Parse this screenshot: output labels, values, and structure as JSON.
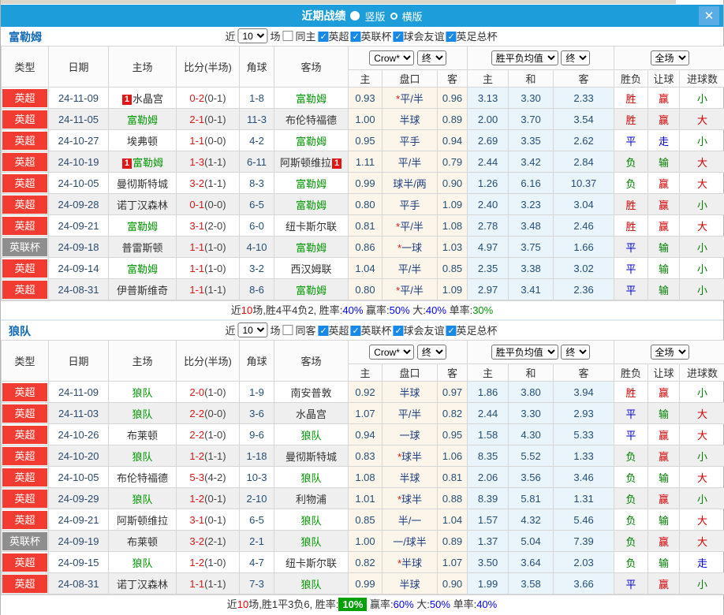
{
  "titlebar": {
    "title": "近期战绩",
    "radio_vertical": "竖版",
    "radio_horizontal": "横版",
    "close": "✕"
  },
  "colors": {
    "titlebar_blue": "#1d9dd9",
    "league_red": "#f23b31",
    "league_gray": "#8e8e8e",
    "focus_team_green": "#009900",
    "win_red": "#d50000",
    "draw_blue": "#0000dd",
    "lose_green": "#008000",
    "odds_cream_bg": "#fcf6ea",
    "avg_blue_bg": "#e9f4fb",
    "highlight_green_bg": "#00a000"
  },
  "headers": {
    "type": "类型",
    "date": "日期",
    "home": "主场",
    "score_half": "比分(半场)",
    "corner": "角球",
    "away": "客场",
    "sub": [
      "主",
      "盘口",
      "客",
      "主",
      "和",
      "客",
      "胜负",
      "让球",
      "进球数"
    ],
    "selects": {
      "bookmaker": "Crow*",
      "final": "终",
      "avg": "胜平负均值",
      "final2": "终",
      "scope": "全场"
    }
  },
  "sections": [
    {
      "team": "富勒姆",
      "filter": {
        "near": "近",
        "count": "10",
        "unit": "场",
        "same": "同主",
        "same_checked": false,
        "leagues": [
          {
            "label": "英超",
            "checked": true
          },
          {
            "label": "英联杯",
            "checked": true
          },
          {
            "label": "球会友谊",
            "checked": true
          },
          {
            "label": "英足总杯",
            "checked": true
          }
        ]
      },
      "rows": [
        {
          "lg": "英超",
          "lgc": "red",
          "date": "24-11-09",
          "h": {
            "n": "水晶宫",
            "g": 0,
            "b": "pre"
          },
          "s": "0-2",
          "sh": "0-1",
          "c": "1-8",
          "a": {
            "n": "富勒姆",
            "g": 1
          },
          "o": [
            "0.93",
            "*平/半",
            "0.96"
          ],
          "v": [
            "3.13",
            "3.30",
            "2.33"
          ],
          "r": [
            "胜",
            "赢",
            "小"
          ]
        },
        {
          "lg": "英超",
          "lgc": "red",
          "date": "24-11-05",
          "h": {
            "n": "富勒姆",
            "g": 1
          },
          "s": "2-1",
          "sh": "0-1",
          "c": "11-3",
          "a": {
            "n": "布伦特福德",
            "g": 0
          },
          "o": [
            "1.00",
            "半球",
            "0.89"
          ],
          "v": [
            "2.00",
            "3.70",
            "3.54"
          ],
          "r": [
            "胜",
            "赢",
            "大"
          ]
        },
        {
          "lg": "英超",
          "lgc": "red",
          "date": "24-10-27",
          "h": {
            "n": "埃弗顿",
            "g": 0
          },
          "s": "1-1",
          "sh": "0-0",
          "c": "4-2",
          "a": {
            "n": "富勒姆",
            "g": 1
          },
          "o": [
            "0.95",
            "平手",
            "0.94"
          ],
          "v": [
            "2.69",
            "3.35",
            "2.62"
          ],
          "r": [
            "平",
            "走",
            "小"
          ]
        },
        {
          "lg": "英超",
          "lgc": "red",
          "date": "24-10-19",
          "h": {
            "n": "富勒姆",
            "g": 1,
            "b": "pre"
          },
          "s": "1-3",
          "sh": "1-1",
          "c": "6-11",
          "a": {
            "n": "阿斯顿维拉",
            "g": 0,
            "b": "post"
          },
          "o": [
            "1.11",
            "平/半",
            "0.79"
          ],
          "v": [
            "2.44",
            "3.42",
            "2.84"
          ],
          "r": [
            "负",
            "输",
            "大"
          ]
        },
        {
          "lg": "英超",
          "lgc": "red",
          "date": "24-10-05",
          "h": {
            "n": "曼彻斯特城",
            "g": 0
          },
          "s": "3-2",
          "sh": "1-1",
          "c": "8-3",
          "a": {
            "n": "富勒姆",
            "g": 1
          },
          "o": [
            "0.99",
            "球半/两",
            "0.90"
          ],
          "v": [
            "1.26",
            "6.16",
            "10.37"
          ],
          "r": [
            "负",
            "赢",
            "大"
          ]
        },
        {
          "lg": "英超",
          "lgc": "red",
          "date": "24-09-28",
          "h": {
            "n": "诺丁汉森林",
            "g": 0
          },
          "s": "0-1",
          "sh": "0-0",
          "c": "6-5",
          "a": {
            "n": "富勒姆",
            "g": 1
          },
          "o": [
            "0.80",
            "平手",
            "1.09"
          ],
          "v": [
            "2.40",
            "3.23",
            "3.04"
          ],
          "r": [
            "胜",
            "赢",
            "小"
          ]
        },
        {
          "lg": "英超",
          "lgc": "red",
          "date": "24-09-21",
          "h": {
            "n": "富勒姆",
            "g": 1
          },
          "s": "3-1",
          "sh": "2-0",
          "c": "6-0",
          "a": {
            "n": "纽卡斯尔联",
            "g": 0
          },
          "o": [
            "0.81",
            "*平/半",
            "1.08"
          ],
          "v": [
            "2.78",
            "3.48",
            "2.46"
          ],
          "r": [
            "胜",
            "赢",
            "大"
          ]
        },
        {
          "lg": "英联杯",
          "lgc": "gray",
          "date": "24-09-18",
          "h": {
            "n": "普雷斯顿",
            "g": 0
          },
          "s": "1-1",
          "sh": "1-0",
          "c": "4-10",
          "a": {
            "n": "富勒姆",
            "g": 1
          },
          "o": [
            "0.86",
            "*一球",
            "1.03"
          ],
          "v": [
            "4.97",
            "3.75",
            "1.66"
          ],
          "r": [
            "平",
            "输",
            "小"
          ]
        },
        {
          "lg": "英超",
          "lgc": "red",
          "date": "24-09-14",
          "h": {
            "n": "富勒姆",
            "g": 1
          },
          "s": "1-1",
          "sh": "1-0",
          "c": "3-2",
          "a": {
            "n": "西汉姆联",
            "g": 0
          },
          "o": [
            "1.04",
            "平/半",
            "0.85"
          ],
          "v": [
            "2.35",
            "3.38",
            "3.02"
          ],
          "r": [
            "平",
            "输",
            "小"
          ]
        },
        {
          "lg": "英超",
          "lgc": "red",
          "date": "24-08-31",
          "h": {
            "n": "伊普斯维奇",
            "g": 0
          },
          "s": "1-1",
          "sh": "1-1",
          "c": "8-6",
          "a": {
            "n": "富勒姆",
            "g": 1
          },
          "o": [
            "0.80",
            "*平/半",
            "1.09"
          ],
          "v": [
            "2.97",
            "3.41",
            "2.36"
          ],
          "r": [
            "平",
            "输",
            "小"
          ]
        }
      ],
      "summary": [
        {
          "t": "近",
          "c": "sk"
        },
        {
          "t": "10",
          "c": "sr"
        },
        {
          "t": "场,胜4平4负2, 胜率:",
          "c": "sk"
        },
        {
          "t": "40%",
          "c": "sb"
        },
        {
          "t": " 赢率:",
          "c": "sk"
        },
        {
          "t": "50%",
          "c": "sb"
        },
        {
          "t": " 大:",
          "c": "sk"
        },
        {
          "t": "40%",
          "c": "sb"
        },
        {
          "t": " 单率:",
          "c": "sk"
        },
        {
          "t": "30%",
          "c": "sg"
        }
      ]
    },
    {
      "team": "狼队",
      "filter": {
        "near": "近",
        "count": "10",
        "unit": "场",
        "same": "同客",
        "same_checked": false,
        "leagues": [
          {
            "label": "英超",
            "checked": true
          },
          {
            "label": "英联杯",
            "checked": true
          },
          {
            "label": "球会友谊",
            "checked": true
          },
          {
            "label": "英足总杯",
            "checked": true
          }
        ]
      },
      "rows": [
        {
          "lg": "英超",
          "lgc": "red",
          "date": "24-11-09",
          "h": {
            "n": "狼队",
            "g": 1
          },
          "s": "2-0",
          "sh": "1-0",
          "c": "1-9",
          "a": {
            "n": "南安普敦",
            "g": 0
          },
          "o": [
            "0.92",
            "半球",
            "0.97"
          ],
          "v": [
            "1.86",
            "3.80",
            "3.94"
          ],
          "r": [
            "胜",
            "赢",
            "小"
          ]
        },
        {
          "lg": "英超",
          "lgc": "red",
          "date": "24-11-03",
          "h": {
            "n": "狼队",
            "g": 1
          },
          "s": "2-2",
          "sh": "0-0",
          "c": "3-6",
          "a": {
            "n": "水晶宫",
            "g": 0
          },
          "o": [
            "1.07",
            "平/半",
            "0.82"
          ],
          "v": [
            "2.44",
            "3.30",
            "2.93"
          ],
          "r": [
            "平",
            "输",
            "大"
          ]
        },
        {
          "lg": "英超",
          "lgc": "red",
          "date": "24-10-26",
          "h": {
            "n": "布莱顿",
            "g": 0
          },
          "s": "2-2",
          "sh": "1-0",
          "c": "9-6",
          "a": {
            "n": "狼队",
            "g": 1
          },
          "o": [
            "0.94",
            "一球",
            "0.95"
          ],
          "v": [
            "1.58",
            "4.30",
            "5.33"
          ],
          "r": [
            "平",
            "赢",
            "大"
          ]
        },
        {
          "lg": "英超",
          "lgc": "red",
          "date": "24-10-20",
          "h": {
            "n": "狼队",
            "g": 1
          },
          "s": "1-2",
          "sh": "1-1",
          "c": "1-18",
          "a": {
            "n": "曼彻斯特城",
            "g": 0
          },
          "o": [
            "0.83",
            "*球半",
            "1.06"
          ],
          "v": [
            "8.35",
            "5.52",
            "1.33"
          ],
          "r": [
            "负",
            "赢",
            "小"
          ]
        },
        {
          "lg": "英超",
          "lgc": "red",
          "date": "24-10-05",
          "h": {
            "n": "布伦特福德",
            "g": 0
          },
          "s": "5-3",
          "sh": "4-2",
          "c": "10-3",
          "a": {
            "n": "狼队",
            "g": 1
          },
          "o": [
            "1.08",
            "半球",
            "0.81"
          ],
          "v": [
            "2.06",
            "3.56",
            "3.46"
          ],
          "r": [
            "负",
            "输",
            "大"
          ]
        },
        {
          "lg": "英超",
          "lgc": "red",
          "date": "24-09-29",
          "h": {
            "n": "狼队",
            "g": 1
          },
          "s": "1-2",
          "sh": "0-1",
          "c": "2-10",
          "a": {
            "n": "利物浦",
            "g": 0
          },
          "o": [
            "1.01",
            "*球半",
            "0.88"
          ],
          "v": [
            "8.39",
            "5.81",
            "1.31"
          ],
          "r": [
            "负",
            "赢",
            "小"
          ]
        },
        {
          "lg": "英超",
          "lgc": "red",
          "date": "24-09-21",
          "h": {
            "n": "阿斯顿维拉",
            "g": 0
          },
          "s": "3-1",
          "sh": "0-1",
          "c": "6-5",
          "a": {
            "n": "狼队",
            "g": 1
          },
          "o": [
            "0.85",
            "半/一",
            "1.04"
          ],
          "v": [
            "1.57",
            "4.32",
            "5.46"
          ],
          "r": [
            "负",
            "输",
            "大"
          ]
        },
        {
          "lg": "英联杯",
          "lgc": "gray",
          "date": "24-09-19",
          "h": {
            "n": "布莱顿",
            "g": 0
          },
          "s": "3-2",
          "sh": "2-1",
          "c": "2-1",
          "a": {
            "n": "狼队",
            "g": 1
          },
          "o": [
            "1.00",
            "一/球半",
            "0.89"
          ],
          "v": [
            "1.37",
            "5.04",
            "7.39"
          ],
          "r": [
            "负",
            "赢",
            "大"
          ]
        },
        {
          "lg": "英超",
          "lgc": "red",
          "date": "24-09-15",
          "h": {
            "n": "狼队",
            "g": 1
          },
          "s": "1-2",
          "sh": "1-0",
          "c": "4-7",
          "a": {
            "n": "纽卡斯尔联",
            "g": 0
          },
          "o": [
            "0.82",
            "*半球",
            "1.07"
          ],
          "v": [
            "3.50",
            "3.64",
            "2.03"
          ],
          "r": [
            "负",
            "输",
            "走"
          ]
        },
        {
          "lg": "英超",
          "lgc": "red",
          "date": "24-08-31",
          "h": {
            "n": "诺丁汉森林",
            "g": 0
          },
          "s": "1-1",
          "sh": "1-1",
          "c": "7-3",
          "a": {
            "n": "狼队",
            "g": 1
          },
          "o": [
            "0.99",
            "半球",
            "0.90"
          ],
          "v": [
            "1.99",
            "3.58",
            "3.66"
          ],
          "r": [
            "平",
            "赢",
            "小"
          ]
        }
      ],
      "summary": [
        {
          "t": "近",
          "c": "sk"
        },
        {
          "t": "10",
          "c": "sr"
        },
        {
          "t": "场,胜1平3负6, 胜率:",
          "c": "sk"
        },
        {
          "t": "10%",
          "c": "shl"
        },
        {
          "t": " 赢率:",
          "c": "sk"
        },
        {
          "t": "60%",
          "c": "sb"
        },
        {
          "t": " 大:",
          "c": "sk"
        },
        {
          "t": "50%",
          "c": "sb"
        },
        {
          "t": " 单率:",
          "c": "sk"
        },
        {
          "t": "40%",
          "c": "sb"
        }
      ]
    }
  ]
}
